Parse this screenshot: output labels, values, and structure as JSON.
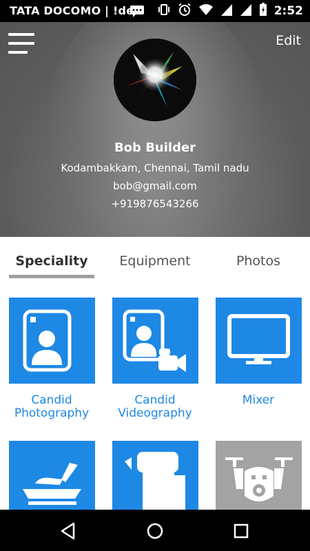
{
  "status_bar": {
    "carrier": "TATA DOCOMO | !dea",
    "time": "2:52",
    "icons": [
      "message-icon",
      "vibrate-icon",
      "alarm-icon",
      "wifi-icon",
      "signal-icon",
      "signal-icon",
      "battery-icon"
    ]
  },
  "header": {
    "edit_label": "Edit",
    "name": "Bob Builder",
    "address": "Kodambakkam, Chennai, Tamil nadu",
    "email": "bob@gmail.com",
    "phone": "+919876543266"
  },
  "tabs": [
    {
      "label": "Speciality",
      "active": true
    },
    {
      "label": "Equipment",
      "active": false
    },
    {
      "label": "Photos",
      "active": false
    }
  ],
  "specialities": [
    {
      "label_line1": "Candid",
      "label_line2": "Photography",
      "icon": "portrait-photo-icon"
    },
    {
      "label_line1": "Candid",
      "label_line2": "Videography",
      "icon": "portrait-video-icon"
    },
    {
      "label_line1": "Mixer",
      "label_line2": "",
      "icon": "monitor-icon"
    },
    {
      "icon": "boat-icon"
    },
    {
      "icon": "roll-up-banner-icon"
    },
    {
      "icon": "drone-icon"
    }
  ],
  "colors": {
    "accent": "#1e88e5",
    "tile_grey": "#a3a3a3",
    "header_bg": "#666666"
  },
  "nav_bar": {
    "buttons": [
      "back-icon",
      "home-icon",
      "recents-icon"
    ]
  }
}
